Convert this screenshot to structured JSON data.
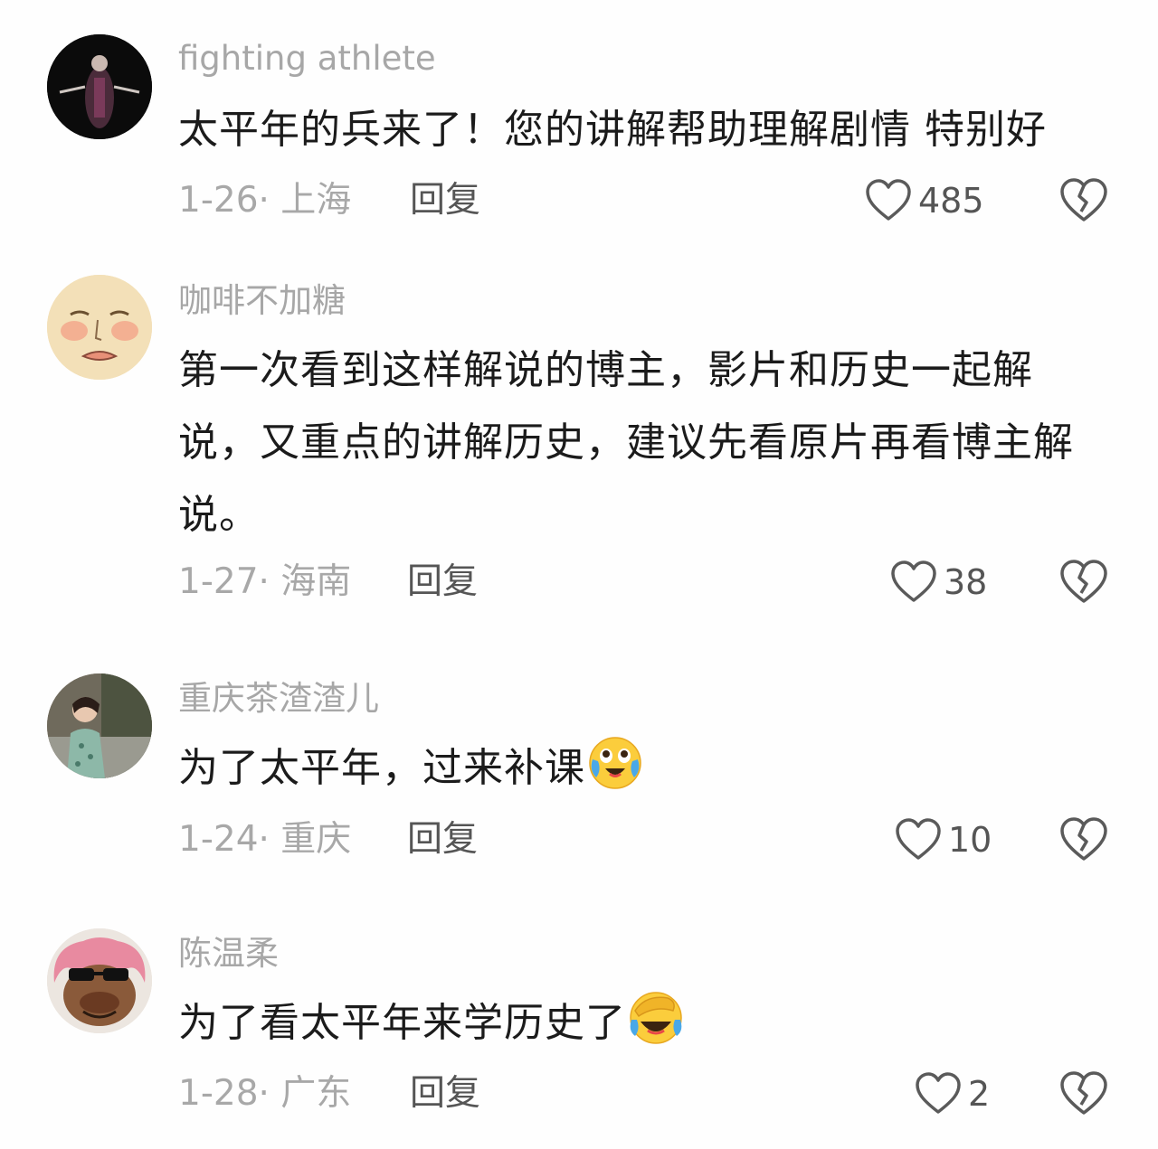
{
  "comments": [
    {
      "username": "fighting athlete",
      "text": "太平年的兵来了！您的讲解帮助理解剧情 特别好",
      "meta": "1-26· 上海",
      "reply": "回复",
      "likes": "485",
      "avatar": "person-in-dark-avatar"
    },
    {
      "username": "咖啡不加糖",
      "text": "第一次看到这样解说的博主，影片和历史一起解说，又重点的讲解历史，建议先看原片再看博主解说。",
      "meta": "1-27· 海南",
      "reply": "回复",
      "likes": "38",
      "avatar": "cartoon-face-avatar"
    },
    {
      "username": "重庆茶渣渣儿",
      "text": "为了太平年，过来补课",
      "emoji": "crying-laughing-emoji",
      "meta": "1-24· 重庆",
      "reply": "回复",
      "likes": "10",
      "avatar": "woman-photo-avatar"
    },
    {
      "username": "陈温柔",
      "text": "为了看太平年来学历史了",
      "emoji": "facepalm-laughing-emoji",
      "meta": "1-28· 广东",
      "reply": "回复",
      "likes": "2",
      "avatar": "pink-hair-sunglasses-avatar"
    }
  ]
}
